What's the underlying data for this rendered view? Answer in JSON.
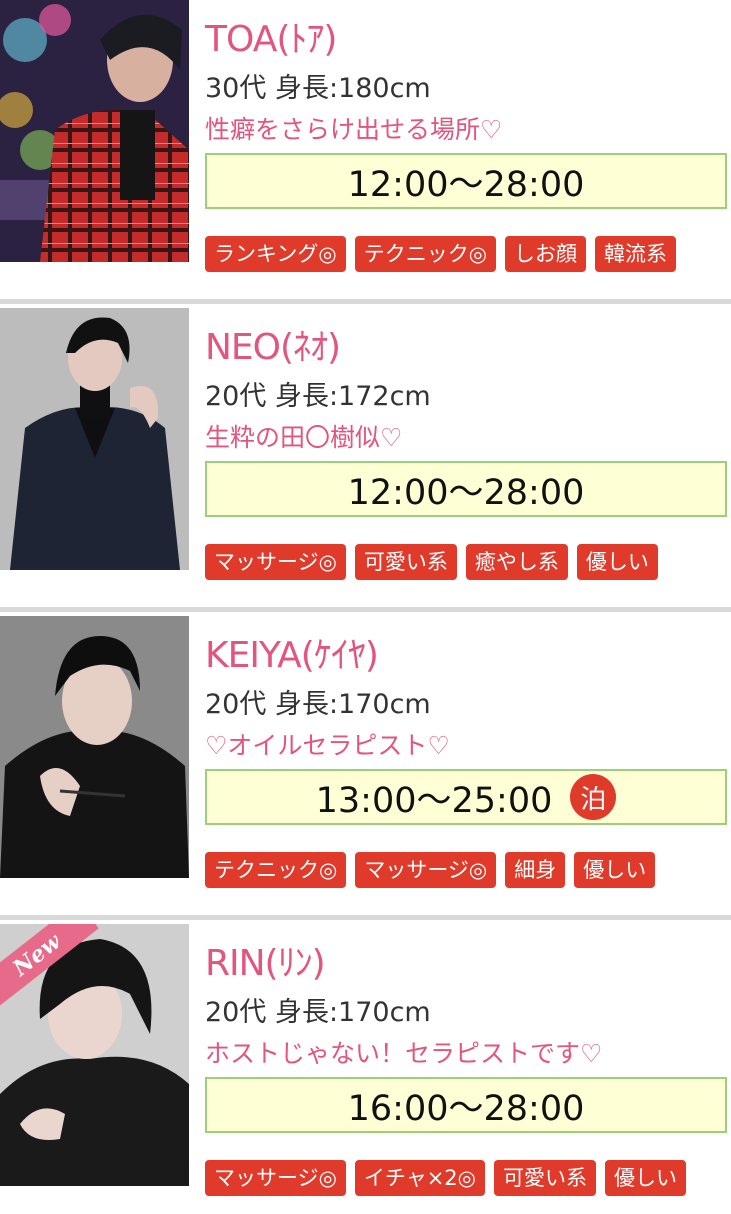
{
  "therapists": [
    {
      "name": "TOA(ﾄｱ)",
      "info": "30代 身長:180cm",
      "catchphrase": "性癖をさらけ出せる場所♡",
      "time": "12:00〜28:00",
      "tags": [
        "ランキング◎",
        "テクニック◎",
        "しお顔",
        "韓流系"
      ]
    },
    {
      "name": "NEO(ﾈｵ)",
      "info": "20代 身長:172cm",
      "catchphrase": "生粋の田〇樹似♡",
      "time": "12:00〜28:00",
      "tags": [
        "マッサージ◎",
        "可愛い系",
        "癒やし系",
        "優しい"
      ]
    },
    {
      "name": "KEIYA(ｹｲﾔ)",
      "info": "20代 身長:170cm",
      "catchphrase": "♡オイルセラピスト♡",
      "time": "13:00〜25:00",
      "stay_badge": "泊",
      "tags": [
        "テクニック◎",
        "マッサージ◎",
        "細身",
        "優しい"
      ]
    },
    {
      "name": "RIN(ﾘﾝ)",
      "info": "20代 身長:170cm",
      "catchphrase": "ホストじゃない！セラピストです♡",
      "time": "16:00〜28:00",
      "new_badge": "New",
      "tags": [
        "マッサージ◎",
        "イチャ×2◎",
        "可愛い系",
        "優しい"
      ]
    }
  ],
  "colors": {
    "name": "#e2557f",
    "tag_bg": "#e03a2b",
    "time_bg": "#ffffd6",
    "time_border": "#9bcf7a"
  }
}
